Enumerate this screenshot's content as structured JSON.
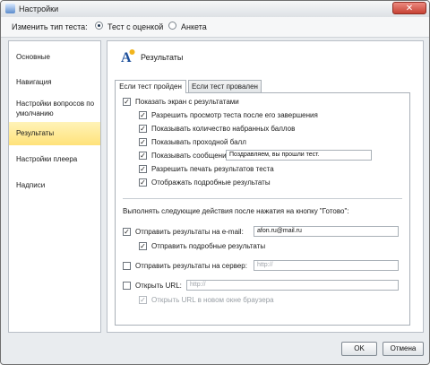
{
  "window": {
    "title": "Настройки",
    "close_symbol": "✕"
  },
  "test_type": {
    "label": "Изменить тип теста:",
    "options": [
      {
        "label": "Тест с оценкой",
        "selected": true
      },
      {
        "label": "Анкета",
        "selected": false
      }
    ]
  },
  "sidebar": {
    "items": [
      {
        "label": "Основные"
      },
      {
        "label": "Навигация"
      },
      {
        "label": "Настройки вопросов по умолчанию"
      },
      {
        "label": "Результаты",
        "active": true
      },
      {
        "label": "Настройки плеера"
      },
      {
        "label": "Надписи"
      }
    ]
  },
  "panel": {
    "title": "Результаты",
    "tabs": [
      {
        "label": "Если тест пройден",
        "active": true
      },
      {
        "label": "Если тест провален",
        "active": false
      }
    ],
    "show_results": {
      "label": "Показать экран с результатами",
      "checked": true
    },
    "options": {
      "allow_review": {
        "label": "Разрешить просмотр теста после его завершения",
        "checked": true
      },
      "show_score": {
        "label": "Показывать количество набранных баллов",
        "checked": true
      },
      "show_passing": {
        "label": "Показывать проходной балл",
        "checked": true
      },
      "show_message": {
        "label": "Показывать сообщения",
        "checked": true,
        "value": "Поздравляем, вы прошли тест."
      },
      "allow_print": {
        "label": "Разрешить печать результатов теста",
        "checked": true
      },
      "show_details": {
        "label": "Отображать подробные результаты",
        "checked": true
      }
    },
    "after_done_label": "Выполнять следующие действия после нажатия на кнопку \"Готово\":",
    "email": {
      "label": "Отправить результаты на e-mail:",
      "checked": true,
      "value": "afon.ru@mail.ru"
    },
    "email_details": {
      "label": "Отправить подробные результаты",
      "checked": true
    },
    "server": {
      "label": "Отправить результаты на сервер:",
      "checked": false,
      "placeholder": "http://"
    },
    "open_url": {
      "label": "Открыть URL:",
      "checked": false,
      "placeholder": "http://"
    },
    "new_window": {
      "label": "Открыть URL в новом окне браузера",
      "checked": true,
      "disabled": true
    }
  },
  "buttons": {
    "ok": "OK",
    "cancel": "Отмена"
  },
  "colors": {
    "active_nav": "#ffe27a",
    "close_button": "#c64234"
  }
}
